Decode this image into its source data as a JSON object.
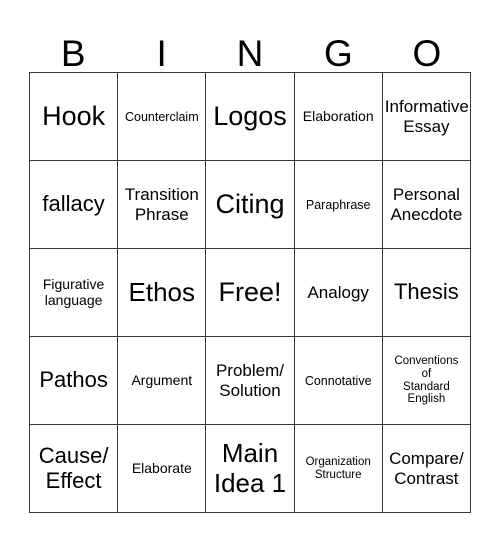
{
  "header": {
    "letters": [
      "B",
      "I",
      "N",
      "G",
      "O"
    ]
  },
  "grid": {
    "rows": 5,
    "columns": 5,
    "border_color": "#3a3a3a",
    "background_color": "#ffffff",
    "text_color": "#000000",
    "cells": [
      {
        "text": "Hook",
        "size": "fs-xl"
      },
      {
        "text": "Counterclaim",
        "size": "fs-xxs"
      },
      {
        "text": "Logos",
        "size": "fs-xl"
      },
      {
        "text": "Elaboration",
        "size": "fs-xs"
      },
      {
        "text": "Informative\nEssay",
        "size": "fs-sm"
      },
      {
        "text": "fallacy",
        "size": "fs-md"
      },
      {
        "text": "Transition\nPhrase",
        "size": "fs-sm"
      },
      {
        "text": "Citing",
        "size": "fs-xl"
      },
      {
        "text": "Paraphrase",
        "size": "fs-xxs"
      },
      {
        "text": "Personal\nAnecdote",
        "size": "fs-sm"
      },
      {
        "text": "Figurative\nlanguage",
        "size": "fs-xs"
      },
      {
        "text": "Ethos",
        "size": "fs-lg"
      },
      {
        "text": "Free!",
        "size": "fs-xl"
      },
      {
        "text": "Analogy",
        "size": "fs-sm"
      },
      {
        "text": "Thesis",
        "size": "fs-md"
      },
      {
        "text": "Pathos",
        "size": "fs-md"
      },
      {
        "text": "Argument",
        "size": "fs-xs"
      },
      {
        "text": "Problem/\nSolution",
        "size": "fs-sm"
      },
      {
        "text": "Connotative",
        "size": "fs-xxs"
      },
      {
        "text": "Conventions\nof\nStandard\nEnglish",
        "size": "fs-tiny"
      },
      {
        "text": "Cause/\nEffect",
        "size": "fs-md"
      },
      {
        "text": "Elaborate",
        "size": "fs-xs"
      },
      {
        "text": "Main\nIdea 1",
        "size": "fs-lg"
      },
      {
        "text": "Organization\nStructure",
        "size": "fs-tiny"
      },
      {
        "text": "Compare/\nContrast",
        "size": "fs-sm"
      }
    ]
  }
}
